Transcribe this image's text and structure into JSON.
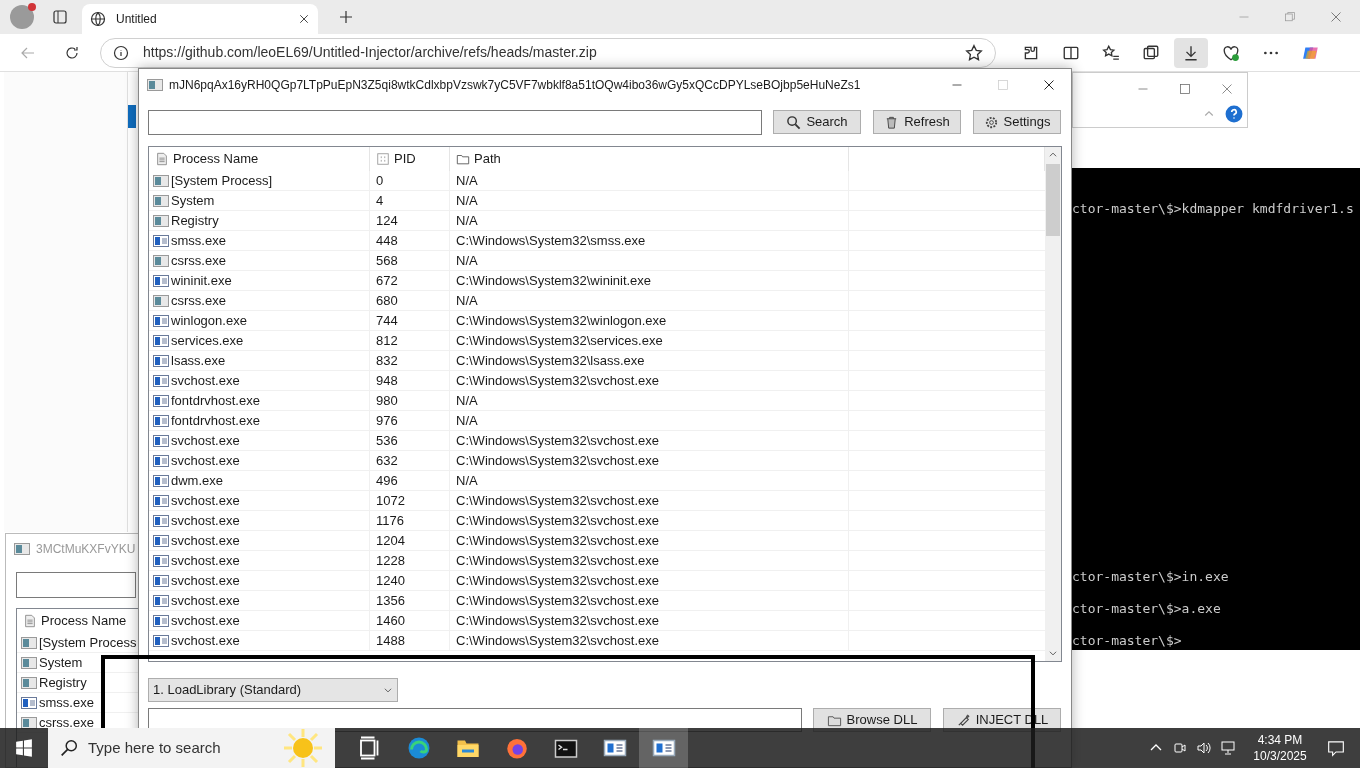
{
  "browser": {
    "tab_title": "Untitled",
    "url": "https://github.com/leoEL69/Untitled-Injector/archive/refs/heads/master.zip"
  },
  "terminal": {
    "lines": [
      "ctor-master\\$>kdmapper kmdfdriver1.s",
      "ctor-master\\$>in.exe",
      "ctor-master\\$>a.exe",
      "ctor-master\\$>"
    ]
  },
  "back_window": {
    "title": "3MCtMuKXFvYKU",
    "column": "Process Name",
    "rows": [
      {
        "kind": "generic",
        "name": "[System Process"
      },
      {
        "kind": "generic",
        "name": "System"
      },
      {
        "kind": "generic",
        "name": "Registry"
      },
      {
        "kind": "app",
        "name": "smss.exe"
      },
      {
        "kind": "generic",
        "name": "csrss.exe"
      }
    ]
  },
  "injector": {
    "title": "mJN6pqAx16yRH0QGp7LTpPuEpN3Z5qi8wtkCdlxbpVzswk7yC5VF7wbklf8a51tOQw4ibo36wGy5xQCcDPYLseBOjbp5eHuNeZs1",
    "buttons": [
      "Search",
      "Refresh",
      "Settings"
    ],
    "columns": [
      "Process Name",
      "PID",
      "Path"
    ],
    "rows": [
      {
        "kind": "generic",
        "name": "[System Process]",
        "pid": "0",
        "path": "N/A"
      },
      {
        "kind": "generic",
        "name": "System",
        "pid": "4",
        "path": "N/A"
      },
      {
        "kind": "generic",
        "name": "Registry",
        "pid": "124",
        "path": "N/A"
      },
      {
        "kind": "app",
        "name": "smss.exe",
        "pid": "448",
        "path": "C:\\Windows\\System32\\smss.exe"
      },
      {
        "kind": "generic",
        "name": "csrss.exe",
        "pid": "568",
        "path": "N/A"
      },
      {
        "kind": "app",
        "name": "wininit.exe",
        "pid": "672",
        "path": "C:\\Windows\\System32\\wininit.exe"
      },
      {
        "kind": "generic",
        "name": "csrss.exe",
        "pid": "680",
        "path": "N/A"
      },
      {
        "kind": "app",
        "name": "winlogon.exe",
        "pid": "744",
        "path": "C:\\Windows\\System32\\winlogon.exe"
      },
      {
        "kind": "app",
        "name": "services.exe",
        "pid": "812",
        "path": "C:\\Windows\\System32\\services.exe"
      },
      {
        "kind": "app",
        "name": "lsass.exe",
        "pid": "832",
        "path": "C:\\Windows\\System32\\lsass.exe"
      },
      {
        "kind": "app",
        "name": "svchost.exe",
        "pid": "948",
        "path": "C:\\Windows\\System32\\svchost.exe"
      },
      {
        "kind": "app",
        "name": "fontdrvhost.exe",
        "pid": "980",
        "path": "N/A"
      },
      {
        "kind": "app",
        "name": "fontdrvhost.exe",
        "pid": "976",
        "path": "N/A"
      },
      {
        "kind": "app",
        "name": "svchost.exe",
        "pid": "536",
        "path": "C:\\Windows\\System32\\svchost.exe"
      },
      {
        "kind": "app",
        "name": "svchost.exe",
        "pid": "632",
        "path": "C:\\Windows\\System32\\svchost.exe"
      },
      {
        "kind": "app",
        "name": "dwm.exe",
        "pid": "496",
        "path": "N/A"
      },
      {
        "kind": "app",
        "name": "svchost.exe",
        "pid": "1072",
        "path": "C:\\Windows\\System32\\svchost.exe"
      },
      {
        "kind": "app",
        "name": "svchost.exe",
        "pid": "1176",
        "path": "C:\\Windows\\System32\\svchost.exe"
      },
      {
        "kind": "app",
        "name": "svchost.exe",
        "pid": "1204",
        "path": "C:\\Windows\\System32\\svchost.exe"
      },
      {
        "kind": "app",
        "name": "svchost.exe",
        "pid": "1228",
        "path": "C:\\Windows\\System32\\svchost.exe"
      },
      {
        "kind": "app",
        "name": "svchost.exe",
        "pid": "1240",
        "path": "C:\\Windows\\System32\\svchost.exe"
      },
      {
        "kind": "app",
        "name": "svchost.exe",
        "pid": "1356",
        "path": "C:\\Windows\\System32\\svchost.exe"
      },
      {
        "kind": "app",
        "name": "svchost.exe",
        "pid": "1460",
        "path": "C:\\Windows\\System32\\svchost.exe"
      },
      {
        "kind": "app",
        "name": "svchost.exe",
        "pid": "1488",
        "path": "C:\\Windows\\System32\\svchost.exe"
      }
    ],
    "method": "1. LoadLibrary (Standard)",
    "bottom_buttons": [
      "Browse DLL",
      "INJECT DLL"
    ]
  },
  "taskbar": {
    "search_placeholder": "Type here to search",
    "apps": [
      {
        "kind": "taskview",
        "selected": false
      },
      {
        "kind": "edge",
        "selected": false
      },
      {
        "kind": "explorer",
        "selected": false
      },
      {
        "kind": "firefox",
        "selected": false
      },
      {
        "kind": "terminal",
        "selected": false
      },
      {
        "kind": "window",
        "selected": false
      },
      {
        "kind": "window",
        "selected": true
      }
    ],
    "time": "4:34 PM",
    "date": "10/3/2025"
  }
}
